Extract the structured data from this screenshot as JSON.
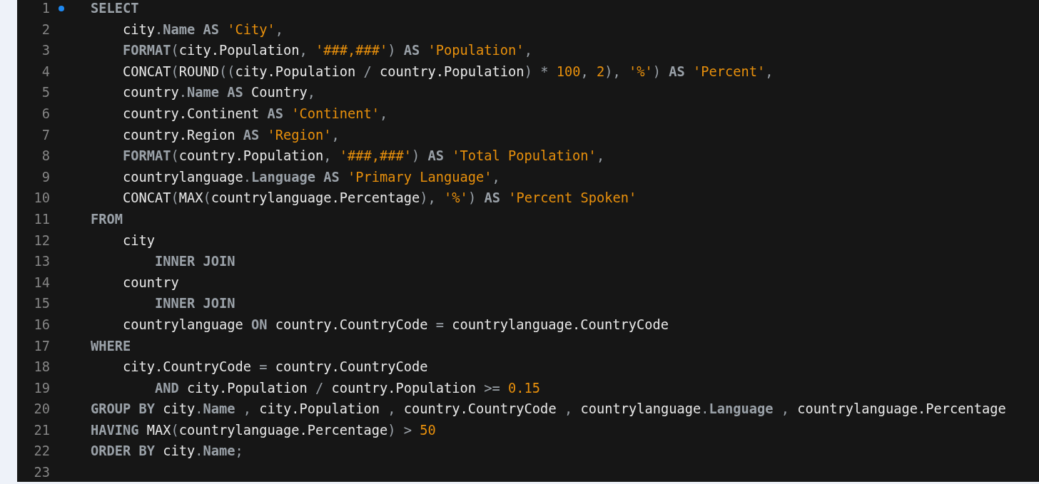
{
  "editor": {
    "lines": [
      {
        "number": "1",
        "marker": true,
        "tokens": [
          {
            "kind": "keyword",
            "text": "SELECT"
          }
        ]
      },
      {
        "number": "2",
        "marker": false,
        "tokens": [
          {
            "kind": "ident",
            "text": "    city"
          },
          {
            "kind": "punct",
            "text": "."
          },
          {
            "kind": "keyword",
            "text": "Name"
          },
          {
            "kind": "keyword",
            "text": " AS"
          },
          {
            "kind": "string",
            "text": " 'City'"
          },
          {
            "kind": "punct",
            "text": ","
          }
        ]
      },
      {
        "number": "3",
        "marker": false,
        "tokens": [
          {
            "kind": "keyword",
            "text": "    FORMAT"
          },
          {
            "kind": "punct",
            "text": "("
          },
          {
            "kind": "ident",
            "text": "city.Population"
          },
          {
            "kind": "punct",
            "text": ", "
          },
          {
            "kind": "string",
            "text": "'###,###'"
          },
          {
            "kind": "punct",
            "text": ")"
          },
          {
            "kind": "keyword",
            "text": " AS"
          },
          {
            "kind": "string",
            "text": " 'Population'"
          },
          {
            "kind": "punct",
            "text": ","
          }
        ]
      },
      {
        "number": "4",
        "marker": false,
        "tokens": [
          {
            "kind": "ident",
            "text": "    CONCAT"
          },
          {
            "kind": "punct",
            "text": "("
          },
          {
            "kind": "ident",
            "text": "ROUND"
          },
          {
            "kind": "punct",
            "text": "(("
          },
          {
            "kind": "ident",
            "text": "city.Population "
          },
          {
            "kind": "punct",
            "text": "/"
          },
          {
            "kind": "ident",
            "text": " country.Population"
          },
          {
            "kind": "punct",
            "text": ")"
          },
          {
            "kind": "punct",
            "text": " *"
          },
          {
            "kind": "number",
            "text": " 100"
          },
          {
            "kind": "punct",
            "text": ", "
          },
          {
            "kind": "number",
            "text": "2"
          },
          {
            "kind": "punct",
            "text": "), "
          },
          {
            "kind": "string",
            "text": "'%'"
          },
          {
            "kind": "punct",
            "text": ")"
          },
          {
            "kind": "keyword",
            "text": " AS"
          },
          {
            "kind": "string",
            "text": " 'Percent'"
          },
          {
            "kind": "punct",
            "text": ","
          }
        ]
      },
      {
        "number": "5",
        "marker": false,
        "tokens": [
          {
            "kind": "ident",
            "text": "    country"
          },
          {
            "kind": "punct",
            "text": "."
          },
          {
            "kind": "keyword",
            "text": "Name"
          },
          {
            "kind": "keyword",
            "text": " AS"
          },
          {
            "kind": "ident",
            "text": " Country"
          },
          {
            "kind": "punct",
            "text": ","
          }
        ]
      },
      {
        "number": "6",
        "marker": false,
        "tokens": [
          {
            "kind": "ident",
            "text": "    country.Continent "
          },
          {
            "kind": "keyword",
            "text": "AS"
          },
          {
            "kind": "string",
            "text": " 'Continent'"
          },
          {
            "kind": "punct",
            "text": ","
          }
        ]
      },
      {
        "number": "7",
        "marker": false,
        "tokens": [
          {
            "kind": "ident",
            "text": "    country.Region "
          },
          {
            "kind": "keyword",
            "text": "AS"
          },
          {
            "kind": "string",
            "text": " 'Region'"
          },
          {
            "kind": "punct",
            "text": ","
          }
        ]
      },
      {
        "number": "8",
        "marker": false,
        "tokens": [
          {
            "kind": "keyword",
            "text": "    FORMAT"
          },
          {
            "kind": "punct",
            "text": "("
          },
          {
            "kind": "ident",
            "text": "country.Population"
          },
          {
            "kind": "punct",
            "text": ", "
          },
          {
            "kind": "string",
            "text": "'###,###'"
          },
          {
            "kind": "punct",
            "text": ")"
          },
          {
            "kind": "keyword",
            "text": " AS"
          },
          {
            "kind": "string",
            "text": " 'Total Population'"
          },
          {
            "kind": "punct",
            "text": ","
          }
        ]
      },
      {
        "number": "9",
        "marker": false,
        "tokens": [
          {
            "kind": "ident",
            "text": "    countrylanguage"
          },
          {
            "kind": "punct",
            "text": "."
          },
          {
            "kind": "keyword",
            "text": "Language"
          },
          {
            "kind": "keyword",
            "text": " AS"
          },
          {
            "kind": "string",
            "text": " 'Primary Language'"
          },
          {
            "kind": "punct",
            "text": ","
          }
        ]
      },
      {
        "number": "10",
        "marker": false,
        "tokens": [
          {
            "kind": "ident",
            "text": "    CONCAT"
          },
          {
            "kind": "punct",
            "text": "("
          },
          {
            "kind": "ident",
            "text": "MAX"
          },
          {
            "kind": "punct",
            "text": "("
          },
          {
            "kind": "ident",
            "text": "countrylanguage.Percentage"
          },
          {
            "kind": "punct",
            "text": "), "
          },
          {
            "kind": "string",
            "text": "'%'"
          },
          {
            "kind": "punct",
            "text": ")"
          },
          {
            "kind": "keyword",
            "text": " AS"
          },
          {
            "kind": "string",
            "text": " 'Percent Spoken'"
          }
        ]
      },
      {
        "number": "11",
        "marker": false,
        "tokens": [
          {
            "kind": "keyword",
            "text": "FROM"
          }
        ]
      },
      {
        "number": "12",
        "marker": false,
        "tokens": [
          {
            "kind": "ident",
            "text": "    city"
          }
        ]
      },
      {
        "number": "13",
        "marker": false,
        "tokens": [
          {
            "kind": "keyword",
            "text": "        INNER JOIN"
          }
        ]
      },
      {
        "number": "14",
        "marker": false,
        "tokens": [
          {
            "kind": "ident",
            "text": "    country"
          }
        ]
      },
      {
        "number": "15",
        "marker": false,
        "tokens": [
          {
            "kind": "keyword",
            "text": "        INNER JOIN"
          }
        ]
      },
      {
        "number": "16",
        "marker": false,
        "tokens": [
          {
            "kind": "ident",
            "text": "    countrylanguage "
          },
          {
            "kind": "keyword",
            "text": "ON"
          },
          {
            "kind": "ident",
            "text": " country.CountryCode "
          },
          {
            "kind": "punct",
            "text": "="
          },
          {
            "kind": "ident",
            "text": " countrylanguage.CountryCode"
          }
        ]
      },
      {
        "number": "17",
        "marker": false,
        "tokens": [
          {
            "kind": "keyword",
            "text": "WHERE"
          }
        ]
      },
      {
        "number": "18",
        "marker": false,
        "tokens": [
          {
            "kind": "ident",
            "text": "    city.CountryCode "
          },
          {
            "kind": "punct",
            "text": "="
          },
          {
            "kind": "ident",
            "text": " country.CountryCode"
          }
        ]
      },
      {
        "number": "19",
        "marker": false,
        "tokens": [
          {
            "kind": "keyword",
            "text": "        AND"
          },
          {
            "kind": "ident",
            "text": " city.Population "
          },
          {
            "kind": "punct",
            "text": "/"
          },
          {
            "kind": "ident",
            "text": " country.Population "
          },
          {
            "kind": "punct",
            "text": ">="
          },
          {
            "kind": "number",
            "text": " 0.15"
          }
        ]
      },
      {
        "number": "20",
        "marker": false,
        "tokens": [
          {
            "kind": "keyword",
            "text": "GROUP BY"
          },
          {
            "kind": "ident",
            "text": " city"
          },
          {
            "kind": "punct",
            "text": "."
          },
          {
            "kind": "keyword",
            "text": "Name"
          },
          {
            "kind": "punct",
            "text": " , "
          },
          {
            "kind": "ident",
            "text": "city.Population "
          },
          {
            "kind": "punct",
            "text": ","
          },
          {
            "kind": "ident",
            "text": " country.CountryCode "
          },
          {
            "kind": "punct",
            "text": ","
          },
          {
            "kind": "ident",
            "text": " countrylanguage"
          },
          {
            "kind": "punct",
            "text": "."
          },
          {
            "kind": "keyword",
            "text": "Language"
          },
          {
            "kind": "punct",
            "text": " , "
          },
          {
            "kind": "ident",
            "text": "countrylanguage.Percentage"
          }
        ]
      },
      {
        "number": "21",
        "marker": false,
        "tokens": [
          {
            "kind": "keyword",
            "text": "HAVING"
          },
          {
            "kind": "ident",
            "text": " MAX"
          },
          {
            "kind": "punct",
            "text": "("
          },
          {
            "kind": "ident",
            "text": "countrylanguage.Percentage"
          },
          {
            "kind": "punct",
            "text": ")"
          },
          {
            "kind": "punct",
            "text": " >"
          },
          {
            "kind": "number",
            "text": " 50"
          }
        ]
      },
      {
        "number": "22",
        "marker": false,
        "tokens": [
          {
            "kind": "keyword",
            "text": "ORDER BY"
          },
          {
            "kind": "ident",
            "text": " city"
          },
          {
            "kind": "punct",
            "text": "."
          },
          {
            "kind": "keyword",
            "text": "Name"
          },
          {
            "kind": "punct",
            "text": ";"
          }
        ]
      },
      {
        "number": "23",
        "marker": false
      }
    ]
  }
}
